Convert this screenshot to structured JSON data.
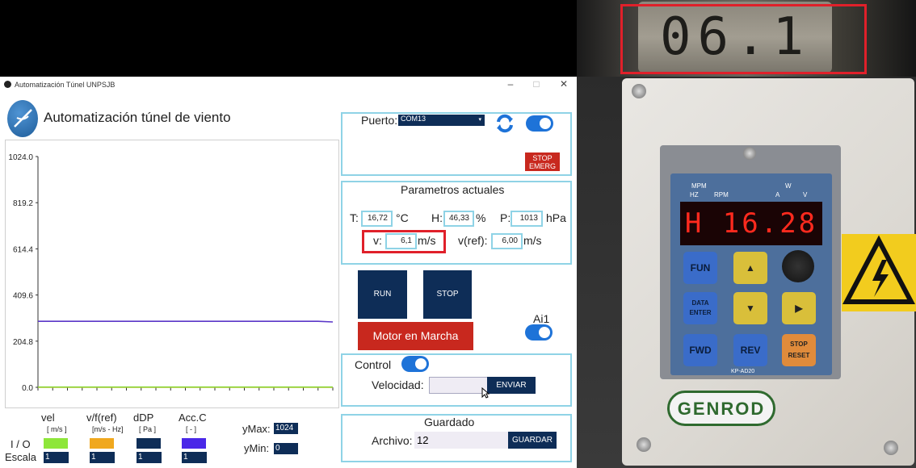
{
  "meter": {
    "reading": "06.1"
  },
  "window": {
    "title": "Automatización Túnel UNPSJB",
    "minimize": "–",
    "maximize": "□",
    "close": "✕"
  },
  "app": {
    "heading": "Automatización túnel de viento"
  },
  "chart_data": {
    "type": "line",
    "x": [
      0,
      1,
      2,
      3,
      4,
      5,
      6,
      7,
      8,
      9,
      10,
      11,
      12,
      13,
      14,
      15,
      16,
      17,
      18,
      19,
      20
    ],
    "series": [
      {
        "color": "#5a36c8",
        "values": [
          293,
          293,
          293,
          293,
          293,
          293,
          293,
          293,
          293,
          293,
          293,
          293,
          293,
          293,
          293,
          293,
          293,
          293,
          293,
          293,
          290
        ]
      },
      {
        "color": "#e7a21a",
        "values": [
          0,
          0,
          0,
          0,
          0,
          0,
          0,
          0,
          0,
          0,
          0,
          0,
          0,
          0,
          0,
          0,
          0,
          0,
          0,
          0,
          0
        ]
      },
      {
        "color": "#8ad83a",
        "values": [
          1,
          1,
          1,
          1,
          1,
          1,
          1,
          1,
          1,
          1,
          1,
          1,
          1,
          1,
          1,
          1,
          1,
          1,
          1,
          1,
          1
        ]
      }
    ],
    "ylim": [
      0,
      1024
    ],
    "yticks": [
      "1024.0",
      "819.2",
      "614.4",
      "409.6",
      "204.8",
      "0.0"
    ]
  },
  "legend": {
    "vel": {
      "label": "vel",
      "unit": "[ m/s ]",
      "color": "#8ee63a",
      "scale": "1"
    },
    "vf": {
      "label": "v/f(ref)",
      "unit": "[m/s - Hz]",
      "color": "#f0a81e",
      "scale": "1"
    },
    "ddp": {
      "label": "dDP",
      "unit": "[ Pa ]",
      "color": "#0e2d57",
      "scale": "1"
    },
    "acc": {
      "label": "Acc.C",
      "unit": "[ - ]",
      "color": "#4a28e8",
      "scale": "1"
    },
    "io_label": "I / O",
    "escala_label": "Escala",
    "ymax_label": "yMax:",
    "ymax": "1024",
    "ymin_label": "yMin:",
    "ymin": "0"
  },
  "port": {
    "label": "Puerto:",
    "value": "COM13",
    "refresh_icon": "refresh-icon",
    "stop_line1": "STOP",
    "stop_line2": "EMERG"
  },
  "params": {
    "title": "Parametros actuales",
    "t_label": "T:",
    "t_value": "16,72",
    "t_unit": "°C",
    "h_label": "H:",
    "h_value": "46,33",
    "h_unit": "%",
    "p_label": "P:",
    "p_value": "1013",
    "p_unit": "hPa",
    "v_label": "v:",
    "v_value": "6,1",
    "v_unit": "m/s",
    "vref_label": "v(ref):",
    "vref_value": "6,00",
    "vref_unit": "m/s"
  },
  "controls": {
    "run": "RUN",
    "stop": "STOP",
    "motor": "Motor en Marcha",
    "ai1": "Ai1"
  },
  "control": {
    "label": "Control",
    "vel_label": "Velocidad:",
    "vel_value": "",
    "send": "ENVIAR"
  },
  "guardado": {
    "title": "Guardado",
    "archivo_label": "Archivo:",
    "archivo_value": "12",
    "save": "GUARDAR"
  },
  "device": {
    "indicators_left": "MPM",
    "indicators_right": "W",
    "hz": "HZ",
    "rpm": "RPM",
    "a": "A",
    "v": "V",
    "display": "H 16.28",
    "fun": "FUN",
    "data": "DATA ENTER",
    "fwd": "FWD",
    "rev": "REV",
    "stop_reset": "STOP RESET",
    "model": "KP-AD20",
    "brand": "GENROD"
  }
}
